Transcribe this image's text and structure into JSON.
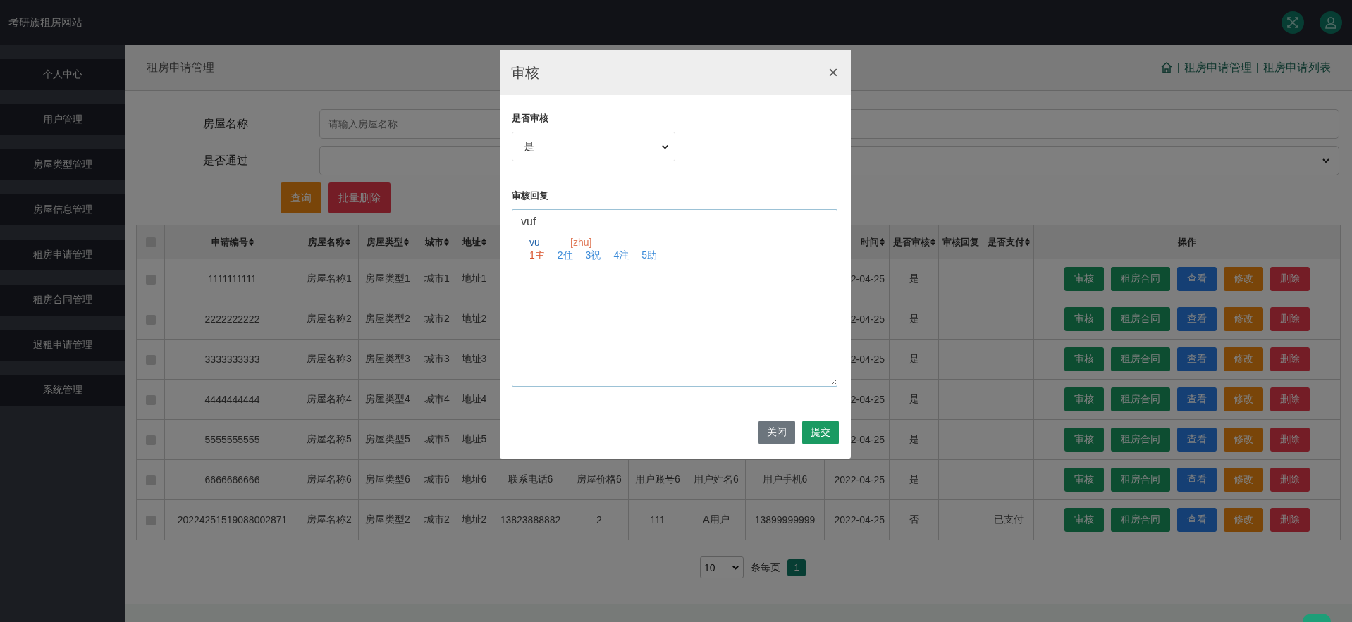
{
  "header": {
    "site_title": "考研族租房网站"
  },
  "sidebar": {
    "items": [
      {
        "label": "个人中心"
      },
      {
        "label": "用户管理"
      },
      {
        "label": "房屋类型管理"
      },
      {
        "label": "房屋信息管理"
      },
      {
        "label": "租房申请管理"
      },
      {
        "label": "租房合同管理"
      },
      {
        "label": "退租申请管理"
      },
      {
        "label": "系统管理"
      }
    ]
  },
  "page_title": "租房申请管理",
  "breadcrumb": [
    {
      "separator": "|",
      "text": "租房申请管理"
    },
    {
      "separator": "|",
      "text": "租房申请列表"
    }
  ],
  "search_form": {
    "fields": [
      {
        "label": "房屋名称",
        "kind": "input",
        "placeholder": "请输入房屋名称"
      },
      {
        "label": "是否通过",
        "kind": "select"
      }
    ],
    "buttons": [
      {
        "label": "查询",
        "kind": "warning"
      },
      {
        "label": "批量删除",
        "kind": "danger"
      }
    ]
  },
  "table": {
    "select_all": {
      "checked": false
    },
    "columns": [
      {
        "label": "申请编号",
        "sortable": true
      },
      {
        "label": "房屋名称",
        "sortable": true
      },
      {
        "label": "房屋类型",
        "sortable": true
      },
      {
        "label": "城市",
        "sortable": true
      },
      {
        "label": "地址",
        "sortable": true
      },
      {},
      {},
      {},
      {},
      {},
      {
        "label": "时间",
        "sortable": true
      },
      {
        "label": "是否审核",
        "sortable": true
      },
      {
        "label": "审核回复",
        "sortable": false
      },
      {
        "label": "是否支付",
        "sortable": true
      },
      {
        "label": "操作",
        "sortable": false
      }
    ],
    "rows": [
      {
        "checked": false,
        "cells": [
          "1111111111",
          "房屋名称1",
          "房屋类型1",
          "城市1",
          "地址1",
          null,
          null,
          null,
          null,
          null,
          "2-04-25",
          "是",
          null,
          null
        ],
        "actions": [
          {
            "label": "审核",
            "kind": "success"
          },
          {
            "label": "租房合同",
            "kind": "success"
          },
          {
            "label": "查看",
            "kind": "primary"
          },
          {
            "label": "修改",
            "kind": "warning"
          },
          {
            "label": "删除",
            "kind": "danger"
          }
        ]
      },
      {
        "checked": false,
        "cells": [
          "2222222222",
          "房屋名称2",
          "房屋类型2",
          "城市2",
          "地址2",
          null,
          null,
          null,
          null,
          null,
          "2-04-25",
          "是",
          null,
          null
        ],
        "actions": [
          {
            "label": "审核",
            "kind": "success"
          },
          {
            "label": "租房合同",
            "kind": "success"
          },
          {
            "label": "查看",
            "kind": "primary"
          },
          {
            "label": "修改",
            "kind": "warning"
          },
          {
            "label": "删除",
            "kind": "danger"
          }
        ]
      },
      {
        "checked": false,
        "cells": [
          "3333333333",
          "房屋名称3",
          "房屋类型3",
          "城市3",
          "地址3",
          null,
          null,
          null,
          null,
          null,
          "2-04-25",
          "是",
          null,
          null
        ],
        "actions": [
          {
            "label": "审核",
            "kind": "success"
          },
          {
            "label": "租房合同",
            "kind": "success"
          },
          {
            "label": "查看",
            "kind": "primary"
          },
          {
            "label": "修改",
            "kind": "warning"
          },
          {
            "label": "删除",
            "kind": "danger"
          }
        ]
      },
      {
        "checked": false,
        "cells": [
          "4444444444",
          "房屋名称4",
          "房屋类型4",
          "城市4",
          "地址4",
          null,
          null,
          null,
          null,
          null,
          "2-04-25",
          "是",
          null,
          null
        ],
        "actions": [
          {
            "label": "审核",
            "kind": "success"
          },
          {
            "label": "租房合同",
            "kind": "success"
          },
          {
            "label": "查看",
            "kind": "primary"
          },
          {
            "label": "修改",
            "kind": "warning"
          },
          {
            "label": "删除",
            "kind": "danger"
          }
        ]
      },
      {
        "checked": false,
        "cells": [
          "5555555555",
          "房屋名称5",
          "房屋类型5",
          "城市5",
          "地址5",
          null,
          null,
          null,
          null,
          null,
          "2-04-25",
          "是",
          null,
          null
        ],
        "actions": [
          {
            "label": "审核",
            "kind": "success"
          },
          {
            "label": "租房合同",
            "kind": "success"
          },
          {
            "label": "查看",
            "kind": "primary"
          },
          {
            "label": "修改",
            "kind": "warning"
          },
          {
            "label": "删除",
            "kind": "danger"
          }
        ]
      },
      {
        "checked": false,
        "cells": [
          "6666666666",
          "房屋名称6",
          "房屋类型6",
          "城市6",
          "地址6",
          "联系电话6",
          "房屋价格6",
          "用户账号6",
          "用户姓名6",
          "用户手机6",
          "2022-04-25",
          "是",
          null,
          null
        ],
        "actions": [
          {
            "label": "审核",
            "kind": "success"
          },
          {
            "label": "租房合同",
            "kind": "success"
          },
          {
            "label": "查看",
            "kind": "primary"
          },
          {
            "label": "修改",
            "kind": "warning"
          },
          {
            "label": "删除",
            "kind": "danger"
          }
        ]
      },
      {
        "checked": false,
        "cells": [
          "20224251519088002871",
          "房屋名称2",
          "房屋类型2",
          "城市2",
          "地址2",
          "13823888882",
          "2",
          "111",
          "A用户",
          "13899999999",
          "2022-04-25",
          "否",
          null,
          "已支付"
        ],
        "actions": [
          {
            "label": "审核",
            "kind": "success"
          },
          {
            "label": "租房合同",
            "kind": "success"
          },
          {
            "label": "查看",
            "kind": "primary"
          },
          {
            "label": "修改",
            "kind": "warning"
          },
          {
            "label": "删除",
            "kind": "danger"
          }
        ]
      }
    ]
  },
  "pagination": {
    "page_size": "10",
    "page_size_label": "条每页",
    "pages": [
      {
        "label": "1",
        "selected": true
      }
    ]
  },
  "modal": {
    "title": "审核",
    "close": "×",
    "fields": [
      {
        "label": "是否审核",
        "kind": "select",
        "value": "是"
      },
      {
        "label": "审核回复",
        "kind": "textarea",
        "value": "vuf"
      }
    ],
    "ime": {
      "composition": "vu",
      "pinyin": "[zhu]",
      "candidates": [
        "1主",
        "2住",
        "3祝",
        "4注",
        "5助"
      ]
    },
    "buttons": [
      {
        "label": "关闭",
        "kind": "secondary"
      },
      {
        "label": "提交",
        "kind": "success"
      }
    ]
  }
}
